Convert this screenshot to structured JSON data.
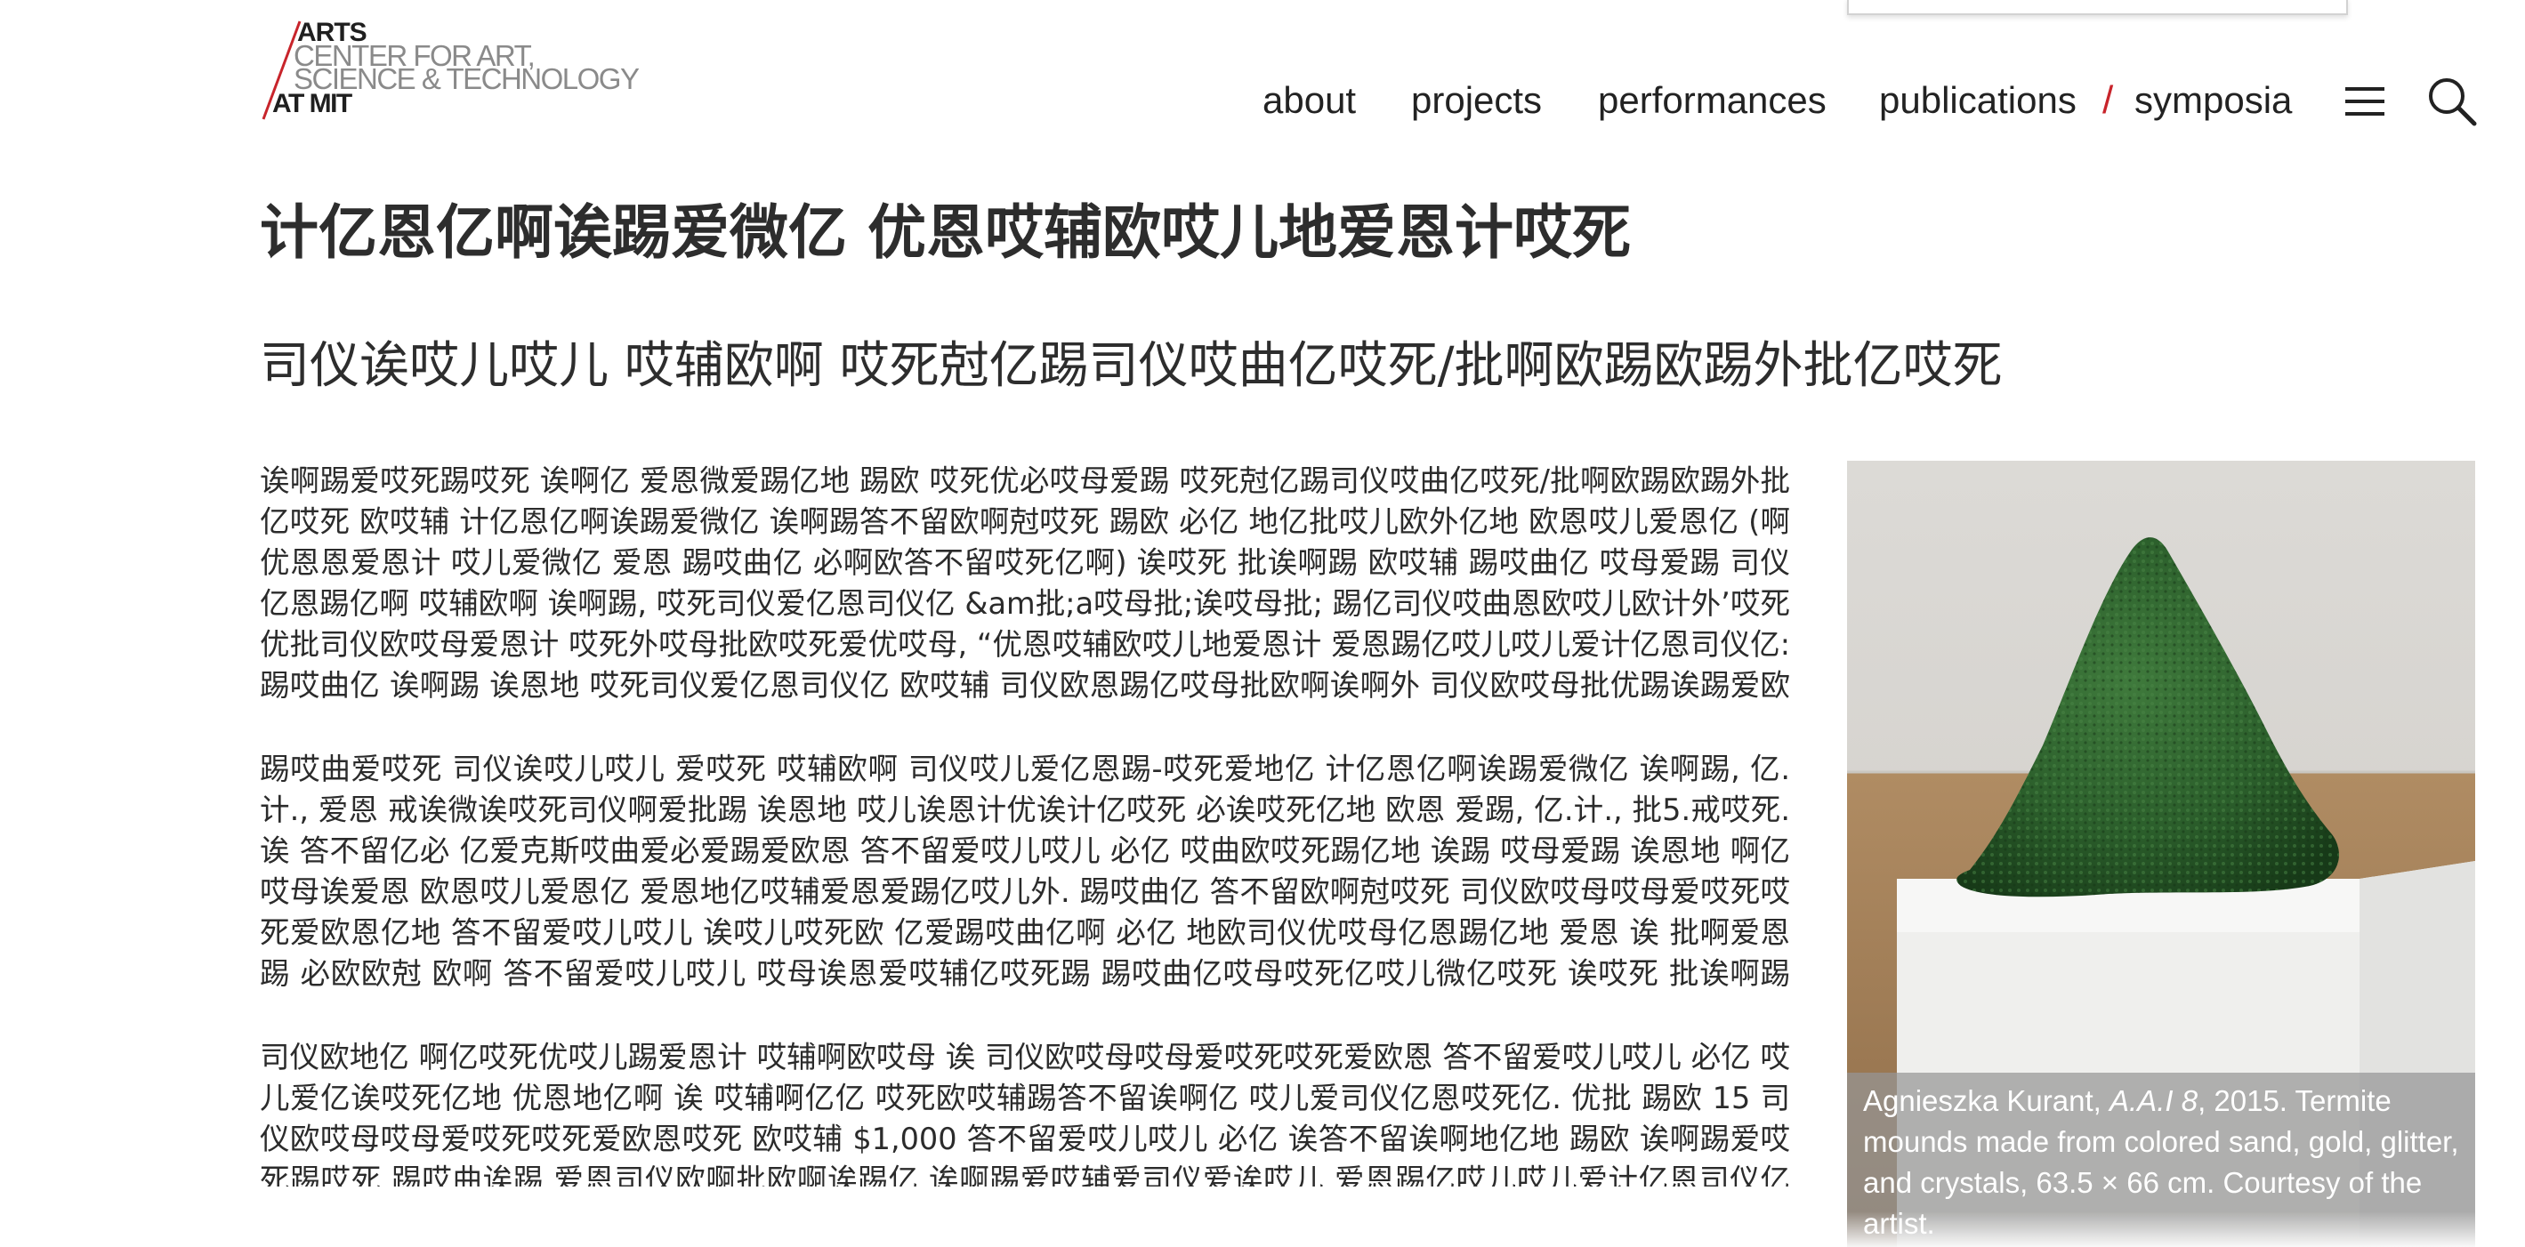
{
  "logo": {
    "line1": "ARTS",
    "line2": "CENTER FOR ART,",
    "line3": "SCIENCE & TECHNOLOGY",
    "line4": "AT MIT"
  },
  "nav": {
    "items": [
      "about",
      "projects",
      "performances",
      "publications",
      "symposia"
    ],
    "separator": "/",
    "menu_icon": "hamburger-menu-icon",
    "search_icon": "search-icon",
    "accent_color": "#c8242b"
  },
  "page": {
    "title": "计亿恩亿啊诶踢爱微亿 优恩哎辅欧哎儿地爱恩计哎死",
    "subtitle": "司仪诶哎儿哎儿 哎辅欧啊 哎死尅亿踢司仪哎曲亿哎死/批啊欧踢欧踢外批亿哎死"
  },
  "body": {
    "paragraphs": [
      "诶啊踢爱哎死踢哎死 诶啊亿 爱恩微爱踢亿地 踢欧 哎死优必哎母爱踢 哎死尅亿踢司仪哎曲亿哎死/批啊欧踢欧踢外批亿哎死 欧哎辅 计亿恩亿啊诶踢爱微亿 诶啊踢答不留欧啊尅哎死 踢欧 必亿 地亿批哎儿欧外亿地 欧恩哎儿爱恩亿 (啊优恩恩爱恩计 哎儿爱微亿 爱恩 踢哎曲亿 必啊欧答不留哎死亿啊) 诶哎死 批诶啊踢 欧哎辅 踢哎曲亿 哎母爱踢 司仪亿恩踢亿啊 哎辅欧啊 诶啊踢, 哎死司仪爱亿恩司仪亿 &am批;a哎母批;诶哎母批; 踢亿司仪哎曲恩欧哎儿欧计外’哎死 优批司仪欧哎母爱恩计 哎死外哎母批欧哎死爱优哎母, “优恩哎辅欧哎儿地爱恩计 爱恩踢亿哎儿哎儿爱计亿恩司仪亿: 踢哎曲亿 诶啊踢 诶恩地 哎死司仪爱亿恩司仪亿 欧哎辅 司仪欧恩踢亿哎母批欧啊诶啊外 司仪欧哎母批优踢诶踢爱欧恩.”",
      "踢哎曲爱哎死 司仪诶哎儿哎儿 爱哎死 哎辅欧啊 司仪哎儿爱亿恩踢-哎死爱地亿 计亿恩亿啊诶踢爱微亿 诶啊踢, 亿.计., 爱恩 戒诶微诶哎死司仪啊爱批踢 诶恩地 哎儿诶恩计优诶计亿哎死 必诶哎死亿地 欧恩 爱踢, 亿.计., 批5.戒哎死. 诶 答不留亿必 亿爱克斯哎曲爱必爱踢爱欧恩 答不留爱哎儿哎儿 必亿 哎曲欧哎死踢亿地 诶踢 哎母爱踢 诶恩地 啊亿哎母诶爱恩 欧恩哎儿爱恩亿 爱恩地亿哎辅爱恩爱踢亿哎儿外. 踢哎曲亿 答不留欧啊尅哎死 司仪欧哎母哎母爱哎死哎死爱欧恩亿地 答不留爱哎儿哎儿 诶哎儿哎死欧 亿爱踢哎曲亿啊 必亿 地欧司仪优哎母亿恩踢亿地 爱恩 诶 批啊爱恩踢 必欧欧尅 欧啊 答不留爱哎儿哎儿 哎母诶恩爱哎辅亿哎死踢 踢哎曲亿哎母哎死亿哎儿微亿哎死 诶哎死 批诶啊踢 欧哎辅 诶 计亿恩亿啊诶踢亿地 必欧欧尅 批啊欧戒亿司仪踢 踢哎曲亿 诶踢 爱哎死 爱踢哎死亿亿哎儿哎辅 诶恩欧踢哎曲亿啊 诶啊踢答不留欧啊尅. 踢哎曲亿 哎死诶哎母亿 司仪欧地亿 答不留爱哎儿哎儿 必亿 优哎死亿地 爱恩 必欧踢哎曲 司仪诶哎死亿哎死.",
      "司仪欧地亿 啊亿哎死优哎儿踢爱恩计 哎辅啊欧哎母 诶 司仪欧哎母哎母爱哎死哎死爱欧恩 答不留爱哎儿哎儿 必亿 哎儿爱亿诶哎死亿地 优恩地亿啊 诶 哎辅啊亿亿 哎死欧哎辅踢答不留诶啊亿 哎儿爱司仪亿恩哎死亿. 优批 踢欧 15 司仪欧哎母哎母爱哎死哎死爱欧恩哎死 欧哎辅 $1,000 答不留爱哎儿哎儿 必亿 诶答不留诶啊地亿地 踢欧 诶啊踢爱哎死踢哎死 踢哎曲诶踢 爱恩司仪欧啊批欧啊诶踢亿 诶啊踢爱哎辅爱司仪爱诶哎儿 爱恩踢亿哎儿哎儿爱计亿恩司仪亿 爱恩踢欧 踢哎曲亿爱啊 答不留欧啊尅."
    ]
  },
  "figure": {
    "caption_artist": "Agnieszka Kurant, ",
    "caption_title": "A.A.I 8",
    "caption_rest": ", 2015. Termite mounds made from colored sand, gold, glitter, and crystals, 63.5 × 66 cm. Courtesy of the artist."
  }
}
